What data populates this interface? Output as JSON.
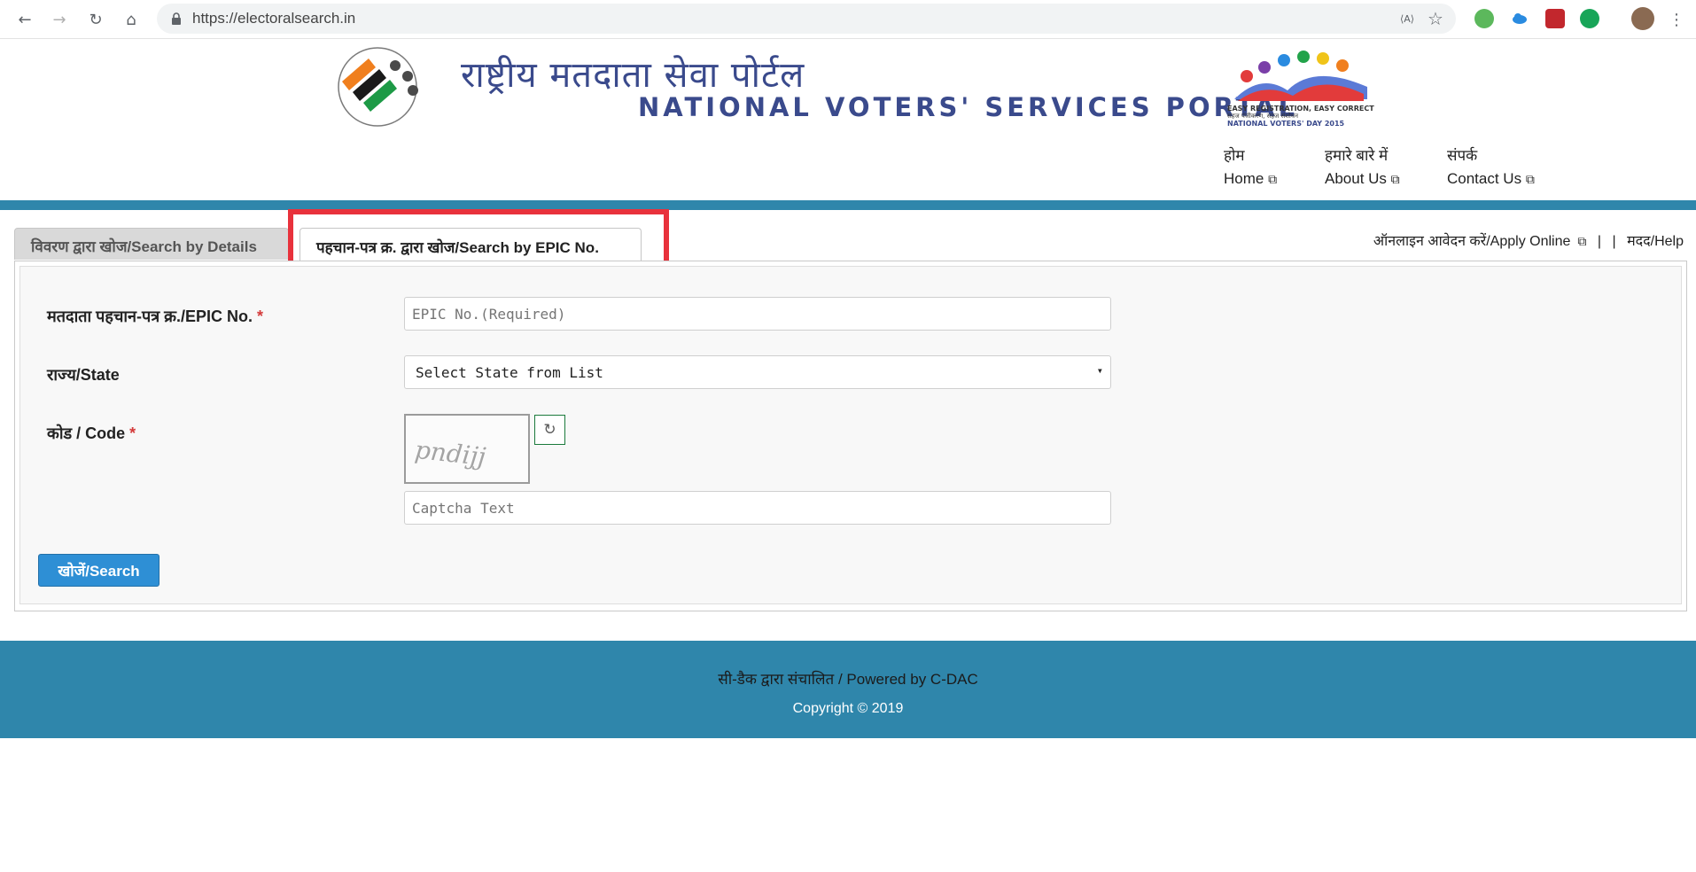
{
  "browser": {
    "url": "https://electoralsearch.in",
    "back_icon": "←",
    "forward_icon": "→",
    "reload_icon": "↻",
    "home_icon": "⌂",
    "translate_icon": "⟨A⟩",
    "star_icon": "☆",
    "menu_icon": "⋮"
  },
  "header": {
    "hindi_title": "राष्ट्रीय मतदाता सेवा पोर्टल",
    "english_title": "NATIONAL VOTERS' SERVICES PORTAL",
    "nvd_text_1": "EASY REGISTRATION, EASY CORRECTION",
    "nvd_text_2": "सहज पंजीकरण, सहज संशोधन",
    "nvd_text_3": "NATIONAL VOTERS' DAY 2015",
    "menu": [
      {
        "hi": "होम",
        "en": "Home"
      },
      {
        "hi": "हमारे बारे में",
        "en": "About Us"
      },
      {
        "hi": "संपर्क",
        "en": "Contact Us"
      }
    ],
    "external_icon": "⧉"
  },
  "tabs": {
    "details": "विवरण द्वारा खोज/Search by Details",
    "epic": "पहचान-पत्र क्र. द्वारा खोज/Search by EPIC No.",
    "apply_online": "ऑनलाइन आवेदन करें/Apply Online",
    "separator": "|",
    "help": "मदद/Help"
  },
  "form": {
    "epic_label": "मतदाता पहचान-पत्र क्र./EPIC No.",
    "epic_placeholder": "EPIC No.(Required)",
    "state_label": "राज्य/State",
    "state_value": "Select State from List",
    "state_arrow": "▾",
    "code_label": "कोड / Code",
    "required_mark": "*",
    "captcha_image_text": "pndijj",
    "refresh_icon": "↻",
    "captcha_placeholder": "Captcha Text",
    "search_button": "खोजें/Search"
  },
  "footer": {
    "powered_by": "सी-डैक द्वारा संचालित / Powered by C-DAC",
    "copyright": "Copyright © 2019"
  },
  "colors": {
    "band": "#2f86ab",
    "title": "#3a4a8c",
    "button": "#2e8fd5",
    "highlight": "#e8323c"
  }
}
